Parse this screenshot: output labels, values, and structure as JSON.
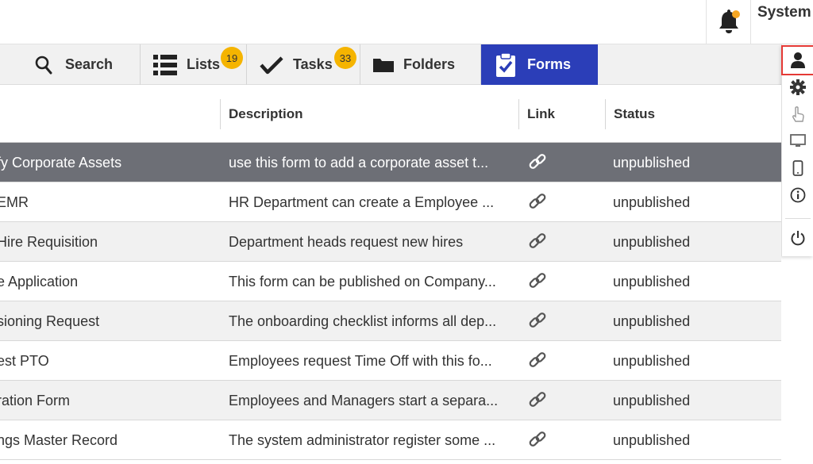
{
  "header": {
    "user_name": "System",
    "icons": {
      "notifications": "bell-icon"
    },
    "colors": {
      "notification_dot": "#f5a623"
    }
  },
  "tabs": [
    {
      "label": "Search",
      "icon": "search-icon"
    },
    {
      "label": "Lists",
      "icon": "list-icon",
      "badge": "19"
    },
    {
      "label": "Tasks",
      "icon": "check-icon",
      "badge": "33"
    },
    {
      "label": "Folders",
      "icon": "folder-icon"
    },
    {
      "label": "Forms",
      "icon": "form-clipboard-icon",
      "active": true
    }
  ],
  "tab_colors": {
    "active_bg": "#2b3eb8",
    "badge": "#f5b400"
  },
  "rail": [
    {
      "icon": "user-icon",
      "active": true
    },
    {
      "icon": "gear-icon"
    },
    {
      "icon": "touch-icon"
    },
    {
      "icon": "monitor-icon"
    },
    {
      "icon": "mobile-icon"
    },
    {
      "icon": "info-icon"
    },
    {
      "icon": "power-icon"
    }
  ],
  "table": {
    "columns": [
      "Description",
      "Link",
      "Status"
    ],
    "rows": [
      {
        "name": "fy Corporate Assets",
        "description": "use this form to add a corporate asset t...",
        "status": "unpublished",
        "selected": true
      },
      {
        "name": "EMR",
        "description": "HR Department can create a Employee ...",
        "status": "unpublished"
      },
      {
        "name": "Hire Requisition",
        "description": "Department heads request new hires",
        "status": "unpublished"
      },
      {
        "name": "e Application",
        "description": "This form can be published on Company...",
        "status": "unpublished"
      },
      {
        "name": "sioning Request",
        "description": "The onboarding checklist informs all dep...",
        "status": "unpublished"
      },
      {
        "name": "est PTO",
        "description": "Employees request Time Off with this fo...",
        "status": "unpublished"
      },
      {
        "name": "ration Form",
        "description": "Employees and Managers start a separa...",
        "status": "unpublished"
      },
      {
        "name": "ngs Master Record",
        "description": "The system administrator register some ...",
        "status": "unpublished"
      }
    ],
    "colors": {
      "selected_row": "#6d6f76",
      "striped_row": "#f1f1f1"
    }
  }
}
